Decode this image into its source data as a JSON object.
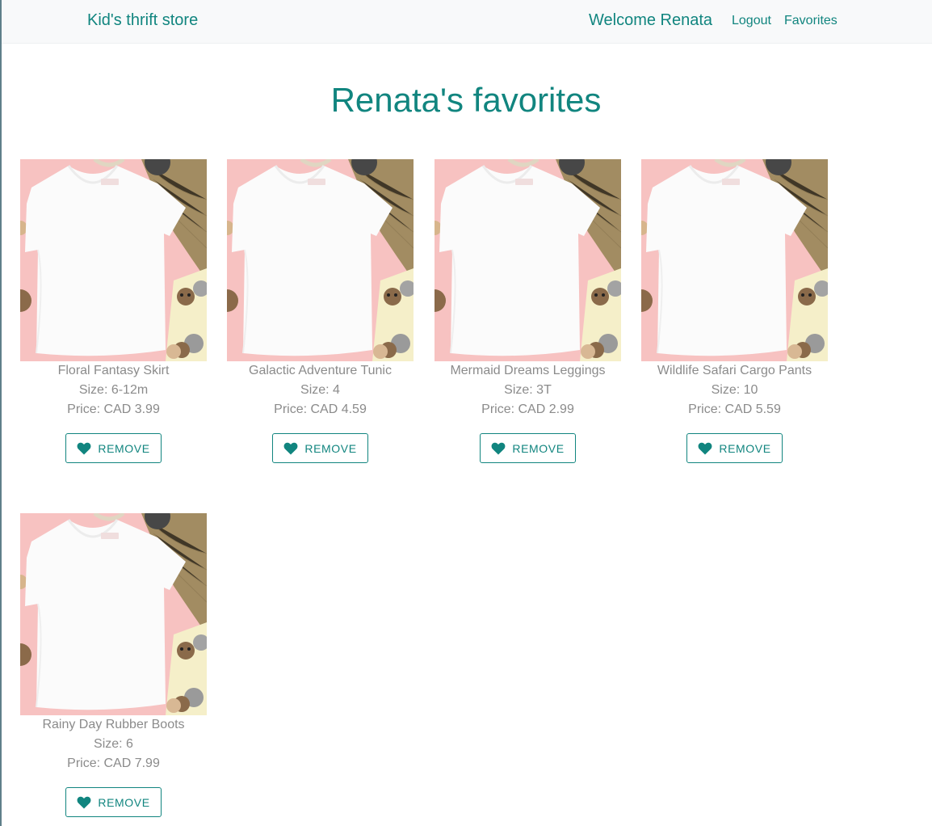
{
  "nav": {
    "brand": "Kid's thrift store",
    "welcome": "Welcome Renata",
    "logout": "Logout",
    "favorites": "Favorites"
  },
  "page": {
    "title": "Renata's favorites"
  },
  "colors": {
    "accent": "#11857f",
    "muted_text": "#8b8b8b",
    "navbar_bg": "#f8f9fa"
  },
  "products": [
    {
      "name": "Floral Fantasy Skirt",
      "size": "Size: 6-12m",
      "price": "Price: CAD 3.99",
      "button": "REMOVE",
      "icon": "heart-icon"
    },
    {
      "name": "Galactic Adventure Tunic",
      "size": "Size: 4",
      "price": "Price: CAD 4.59",
      "button": "REMOVE",
      "icon": "heart-icon"
    },
    {
      "name": "Mermaid Dreams Leggings",
      "size": "Size: 3T",
      "price": "Price: CAD 2.99",
      "button": "REMOVE",
      "icon": "heart-icon"
    },
    {
      "name": "Wildlife Safari Cargo Pants",
      "size": "Size: 10",
      "price": "Price: CAD 5.59",
      "button": "REMOVE",
      "icon": "heart-icon"
    },
    {
      "name": "Rainy Day Rubber Boots",
      "size": "Size: 6",
      "price": "Price: CAD 7.99",
      "button": "REMOVE",
      "icon": "heart-icon"
    }
  ]
}
